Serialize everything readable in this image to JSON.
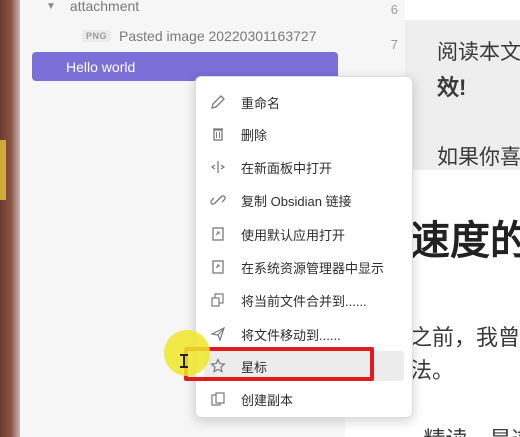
{
  "sidebar": {
    "folder": {
      "label": "attachment",
      "expanded": true
    },
    "file": {
      "badge": "PNG",
      "label": "Pasted image 20220301163727"
    },
    "active_file": {
      "label": "Hello world"
    }
  },
  "editor": {
    "line_numbers": [
      "6",
      "7"
    ],
    "lines": [
      "阅读本文",
      "效!",
      "如果你喜",
      "速度的",
      "之前，我曾",
      "法。",
      "- 精读，是这"
    ]
  },
  "context_menu": {
    "items": [
      {
        "label": "重命名",
        "icon": "pencil-icon"
      },
      {
        "label": "删除",
        "icon": "trash-icon"
      },
      {
        "label": "在新面板中打开",
        "icon": "split-pane-icon"
      },
      {
        "label": "复制 Obsidian 链接",
        "icon": "link-icon"
      },
      {
        "label": "使用默认应用打开",
        "icon": "open-file-icon"
      },
      {
        "label": "在系统资源管理器中显示",
        "icon": "open-file-icon"
      },
      {
        "label": "将当前文件合并到......",
        "icon": "merge-icon"
      },
      {
        "label": "将文件移动到......",
        "icon": "send-icon"
      },
      {
        "label": "星标",
        "icon": "star-icon"
      },
      {
        "label": "创建副本",
        "icon": "copy-icon"
      }
    ],
    "highlighted_item": "星标"
  },
  "colors": {
    "active_file_bg": "#7d6fd8",
    "highlight_border": "#e21c1c",
    "cursor_halo": "#f0e628"
  }
}
